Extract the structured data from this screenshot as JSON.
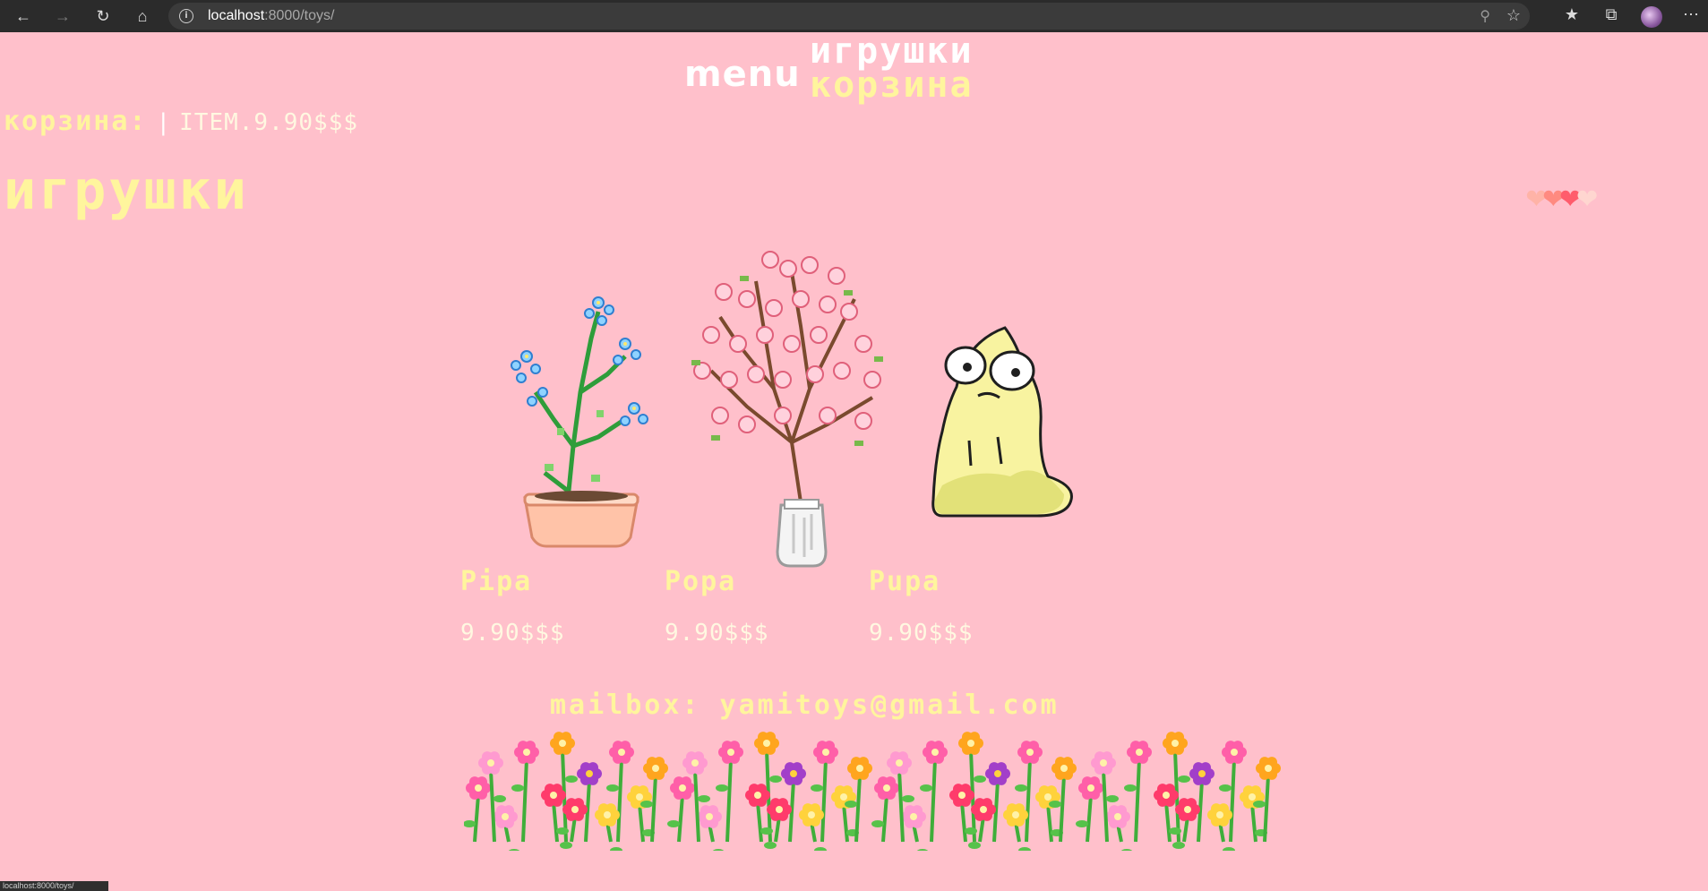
{
  "browser": {
    "url_host": "localhost",
    "url_rest": ":8000/toys/",
    "icons": [
      "back-arrow-icon",
      "forward-arrow-icon",
      "reload-icon",
      "home-icon",
      "info-icon",
      "zoom-icon",
      "star-add-icon",
      "favorites-icon",
      "collections-icon",
      "profile-avatar",
      "more-icon"
    ]
  },
  "nav": {
    "menu_label": "menu",
    "links": [
      "игрушки",
      "корзина"
    ]
  },
  "cart": {
    "label": "корзина:",
    "separator": "|",
    "item_text": "ITEM.9.90$$$"
  },
  "page": {
    "heading": "игрушки"
  },
  "hearts": {
    "colors": [
      "#ffb3a7",
      "#ff8a80",
      "#ff5c6c",
      "#ffd6d0"
    ]
  },
  "products": [
    {
      "name": "Pipa",
      "price": "9.90$$$",
      "image": "blue-flower-pot-image"
    },
    {
      "name": "Popa",
      "price": "9.90$$$",
      "image": "cherry-blossom-vase-image"
    },
    {
      "name": "Pupa",
      "price": "9.90$$$",
      "image": "yellow-creature-image"
    }
  ],
  "footer": {
    "mailbox": "mailbox: yamitoys@gmail.com"
  },
  "status_bar": {
    "text": "localhost:8000/toys/"
  },
  "colors": {
    "background": "#ffc0cb",
    "accent_yellow": "#fff59d",
    "chrome_dark": "#2b2b2b"
  }
}
